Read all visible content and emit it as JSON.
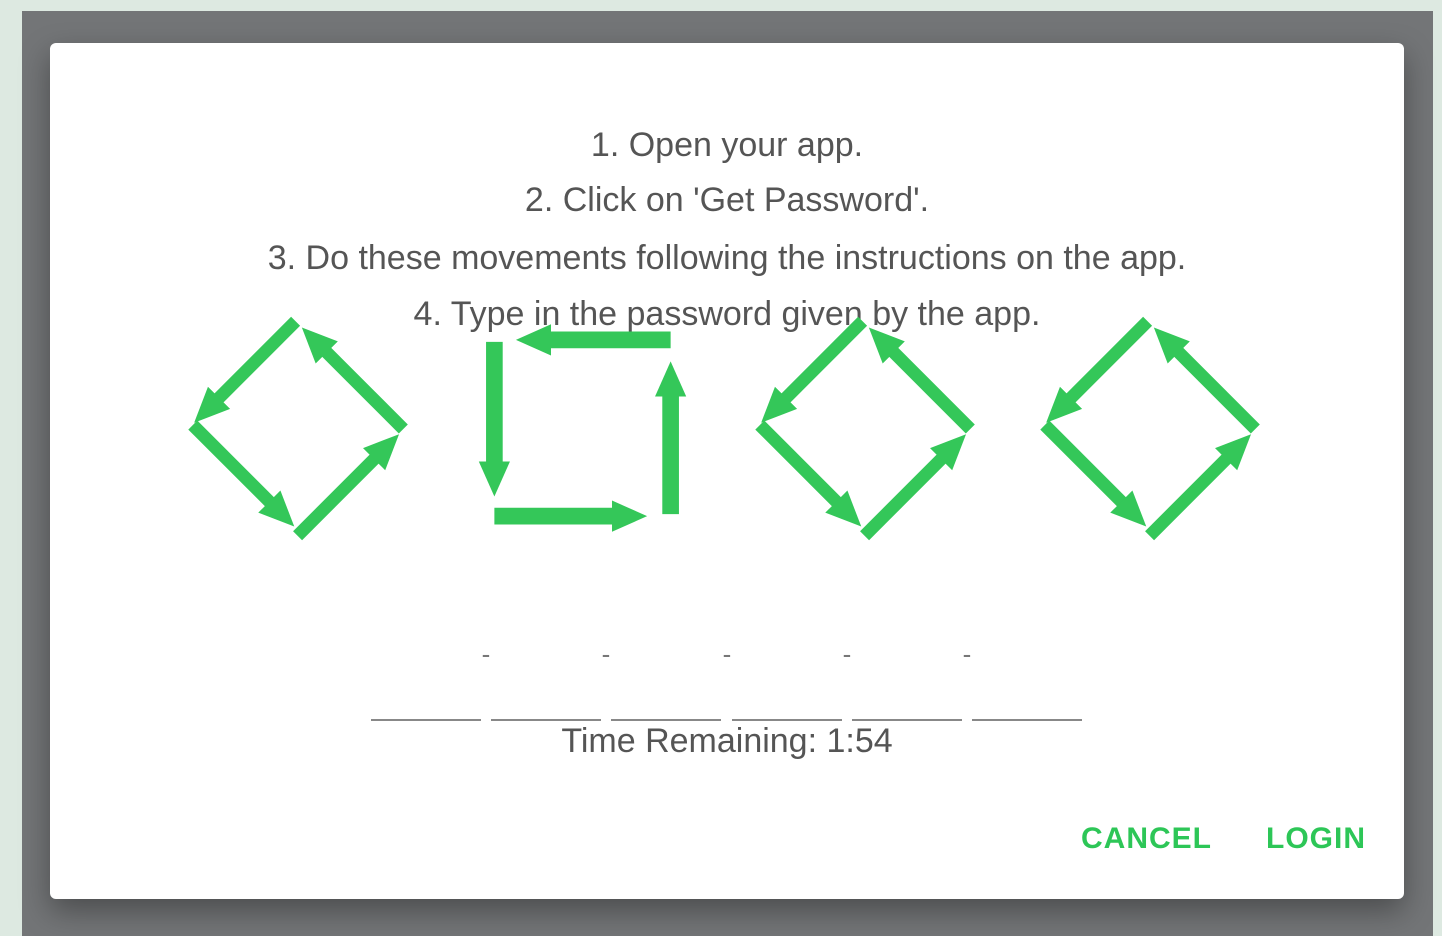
{
  "instructions": [
    "1. Open your app.",
    "2. Click on 'Get Password'.",
    "3. Do these movements following the instructions on the app.",
    "4. Type in the password given by the app."
  ],
  "movement_icons": [
    {
      "name": "diamond-counterclockwise-icon"
    },
    {
      "name": "square-counterclockwise-icon"
    },
    {
      "name": "diamond-counterclockwise-icon"
    },
    {
      "name": "diamond-counterclockwise-icon"
    }
  ],
  "password": {
    "separators": [
      "-",
      "-",
      "-",
      "-",
      "-"
    ],
    "slots": [
      "",
      "",
      "",
      "",
      "",
      ""
    ]
  },
  "timer": "Time Remaining: 1:54",
  "buttons": {
    "cancel": "CANCEL",
    "login": "LOGIN"
  },
  "colors": {
    "accent": "#2dc657",
    "text": "#555555",
    "scrim": "#737577",
    "background": "#dde9e1"
  }
}
